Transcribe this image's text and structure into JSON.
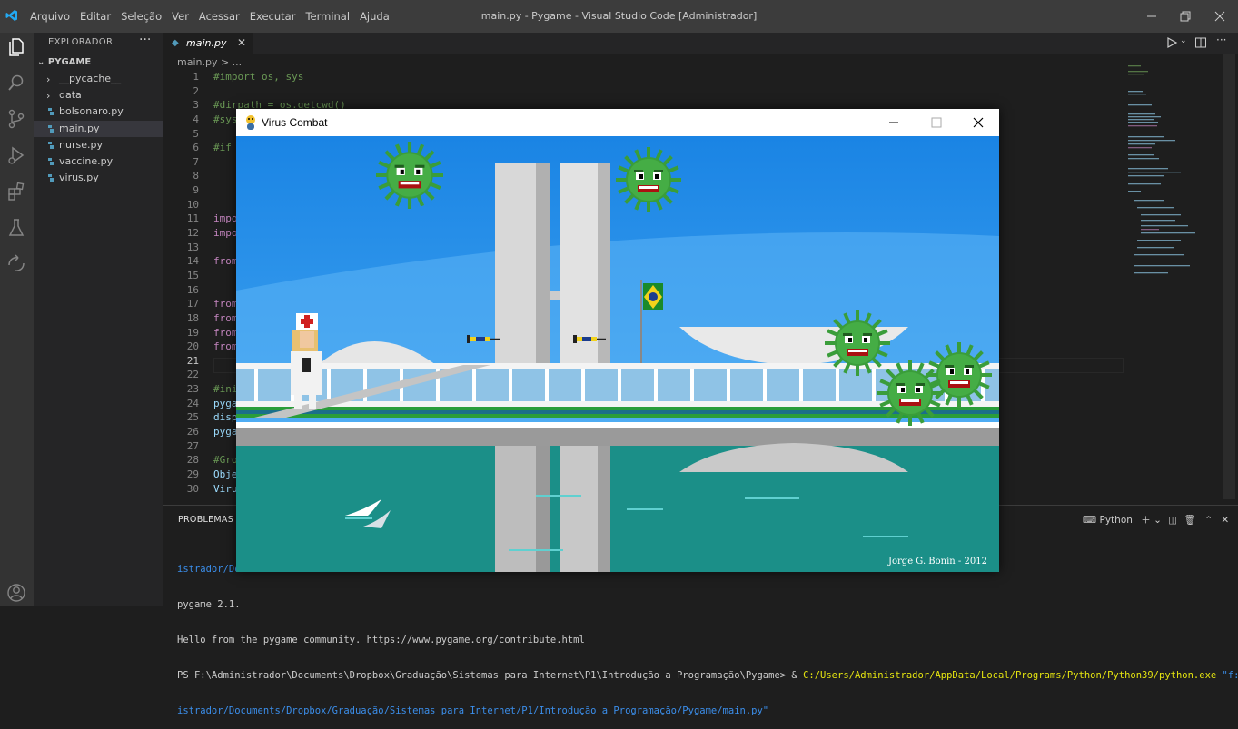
{
  "titlebar": {
    "menu": [
      "Arquivo",
      "Editar",
      "Seleção",
      "Ver",
      "Acessar",
      "Executar",
      "Terminal",
      "Ajuda"
    ],
    "title": "main.py - Pygame - Visual Studio Code [Administrador]"
  },
  "sidebar": {
    "header": "EXPLORADOR",
    "more": "···",
    "project": "PYGAME",
    "items": [
      {
        "label": "__pycache__",
        "kind": "folder"
      },
      {
        "label": "data",
        "kind": "folder"
      },
      {
        "label": "bolsonaro.py",
        "kind": "python"
      },
      {
        "label": "main.py",
        "kind": "python",
        "selected": true
      },
      {
        "label": "nurse.py",
        "kind": "python"
      },
      {
        "label": "vaccine.py",
        "kind": "python"
      },
      {
        "label": "virus.py",
        "kind": "python"
      }
    ]
  },
  "editor": {
    "tab": "main.py",
    "breadcrumb": "main.py > ...",
    "line_numbers": [
      "1",
      "2",
      "3",
      "4",
      "5",
      "6",
      "7",
      "8",
      "9",
      "10",
      "11",
      "12",
      "13",
      "14",
      "15",
      "16",
      "17",
      "18",
      "19",
      "20",
      "21",
      "22",
      "23",
      "24",
      "25",
      "26",
      "27",
      "28",
      "29",
      "30"
    ],
    "lines": [
      "#import os, sys",
      "",
      "#dirpath = os.getcwd()",
      "#sys",
      "",
      "#if",
      "",
      "",
      "",
      "",
      "impo",
      "impo",
      "",
      "from",
      "",
      "",
      "from",
      "from",
      "from",
      "from",
      "",
      "",
      "#ini",
      "pyga",
      "disp",
      "pyga",
      "",
      "#Gro",
      "Obje",
      "Viru"
    ]
  },
  "panel": {
    "tab": "PROBLEMAS",
    "shell": "Python",
    "terminal_lines": [
      "istrador/Do",
      "pygame 2.1.",
      "Hello from the pygame community. https://www.pygame.org/contribute.html"
    ],
    "prompt": "PS F:\\Administrador\\Documents\\Dropbox\\Graduação\\Sistemas para Internet\\P1\\Introdução a Programação\\Pygame> & ",
    "command": "C:/Users/Administrador/AppData/Local/Programs/Python/Python39/python.exe",
    "arg1": " \"f:/Admin",
    "arg2": "istrador/Documents/Dropbox/Graduação/Sistemas para Internet/P1/Introdução a Programação/Pygame/main.py\""
  },
  "game": {
    "window_title": "Virus Combat",
    "credit": "Jorge G. Bonin - 2012"
  },
  "colors": {
    "titlebar": "#3c3c3c",
    "activity": "#333333",
    "sidebar": "#252526",
    "editor": "#1e1e1e",
    "sky": "#1a87e6",
    "virus": "#3a9d3a",
    "water": "#1b8f88"
  }
}
